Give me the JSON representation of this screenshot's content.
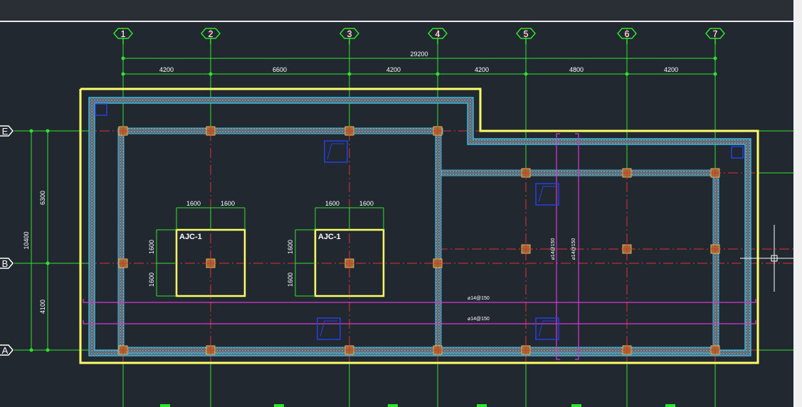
{
  "grid": {
    "columns": [
      "1",
      "2",
      "3",
      "4",
      "5",
      "6",
      "7"
    ],
    "rows": [
      "E",
      "B",
      "A"
    ]
  },
  "dims": {
    "overall_top": "29200",
    "top_spans": [
      "4200",
      "6600",
      "4200",
      "4200",
      "4800",
      "4200"
    ],
    "left_total": "10400",
    "left_spans": [
      "6300",
      "4100"
    ]
  },
  "pits": [
    {
      "label": "AJC-1",
      "top_dims": [
        "1600",
        "1600"
      ],
      "side_dims": [
        "1600",
        "1600"
      ]
    },
    {
      "label": "AJC-1",
      "top_dims": [
        "1600",
        "1600"
      ],
      "side_dims": [
        "1600",
        "1600"
      ]
    }
  ],
  "rebar_notes": {
    "vertical_1": "⌀14@150",
    "vertical_2": "⌀14@150",
    "horizontal_1": "⌀14@150",
    "horizontal_2": "⌀14@150"
  },
  "colors": {
    "background": "#212830",
    "grid_green": "#2ee32e",
    "axis_red": "#e03030",
    "outline_yellow": "#ffff66",
    "wall_cyan": "#38b6e0",
    "rebar_magenta": "#d83ad8",
    "column_orange": "#c88a3a",
    "symbol_blue": "#2840e0"
  }
}
